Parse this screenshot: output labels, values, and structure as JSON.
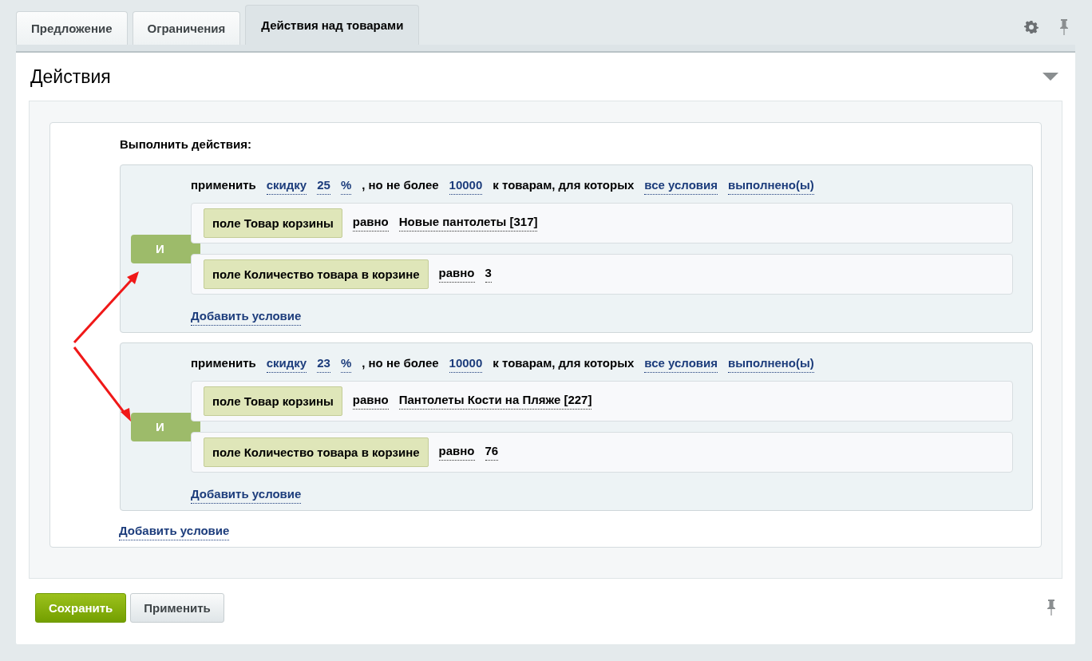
{
  "tabs": [
    {
      "label": "Предложение",
      "selected": false
    },
    {
      "label": "Ограничения",
      "selected": false
    },
    {
      "label": "Действия над товарами",
      "selected": true
    }
  ],
  "section": {
    "title": "Действия",
    "expanded": true
  },
  "actions_label": "Выполнить действия:",
  "actions": [
    {
      "logic": "И",
      "sentence": [
        {
          "kind": "text",
          "text": "применить"
        },
        {
          "kind": "link",
          "text": "скидку"
        },
        {
          "kind": "link",
          "text": "25"
        },
        {
          "kind": "link",
          "text": "%"
        },
        {
          "kind": "text",
          "text": ", но не более"
        },
        {
          "kind": "link",
          "text": "10000"
        },
        {
          "kind": "text",
          "text": "к товарам, для которых"
        },
        {
          "kind": "link",
          "text": "все условия"
        },
        {
          "kind": "link",
          "text": "выполнено(ы)"
        }
      ],
      "conditions": [
        {
          "field": "поле Товар корзины",
          "operator": "равно",
          "value": "Новые пантолеты [317]"
        },
        {
          "field": "поле Количество товара в корзине",
          "operator": "равно",
          "value": "3"
        }
      ],
      "add_label": "Добавить условие"
    },
    {
      "logic": "И",
      "sentence": [
        {
          "kind": "text",
          "text": "применить"
        },
        {
          "kind": "link",
          "text": "скидку"
        },
        {
          "kind": "link",
          "text": "23"
        },
        {
          "kind": "link",
          "text": "%"
        },
        {
          "kind": "text",
          "text": ", но не более"
        },
        {
          "kind": "link",
          "text": "10000"
        },
        {
          "kind": "text",
          "text": "к товарам, для которых"
        },
        {
          "kind": "link",
          "text": "все условия"
        },
        {
          "kind": "link",
          "text": "выполнено(ы)"
        }
      ],
      "conditions": [
        {
          "field": "поле Товар корзины",
          "operator": "равно",
          "value": "Пантолеты Кости на Пляже [227]"
        },
        {
          "field": "поле Количество товара в корзине",
          "operator": "равно",
          "value": "76"
        }
      ],
      "add_label": "Добавить условие"
    }
  ],
  "add_label": "Добавить условие",
  "buttons": [
    {
      "label": "Сохранить",
      "kind": "primary"
    },
    {
      "label": "Применить",
      "kind": "default"
    }
  ]
}
